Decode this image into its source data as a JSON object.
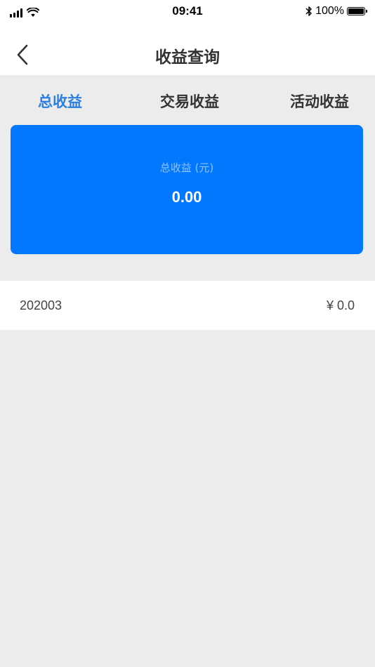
{
  "status_bar": {
    "time": "09:41",
    "battery": "100%"
  },
  "nav": {
    "title": "收益查询",
    "back_icon": "chevron-left-icon"
  },
  "tabs": [
    {
      "label": "总收益",
      "active": true
    },
    {
      "label": "交易收益",
      "active": false
    },
    {
      "label": "活动收益",
      "active": false
    }
  ],
  "summary": {
    "label": "总收益 (元)",
    "value": "0.00"
  },
  "records": [
    {
      "period": "202003",
      "amount": "¥ 0.0"
    }
  ],
  "colors": {
    "accent": "#2b7fe0",
    "card": "#0278fe",
    "background": "#ececec"
  }
}
